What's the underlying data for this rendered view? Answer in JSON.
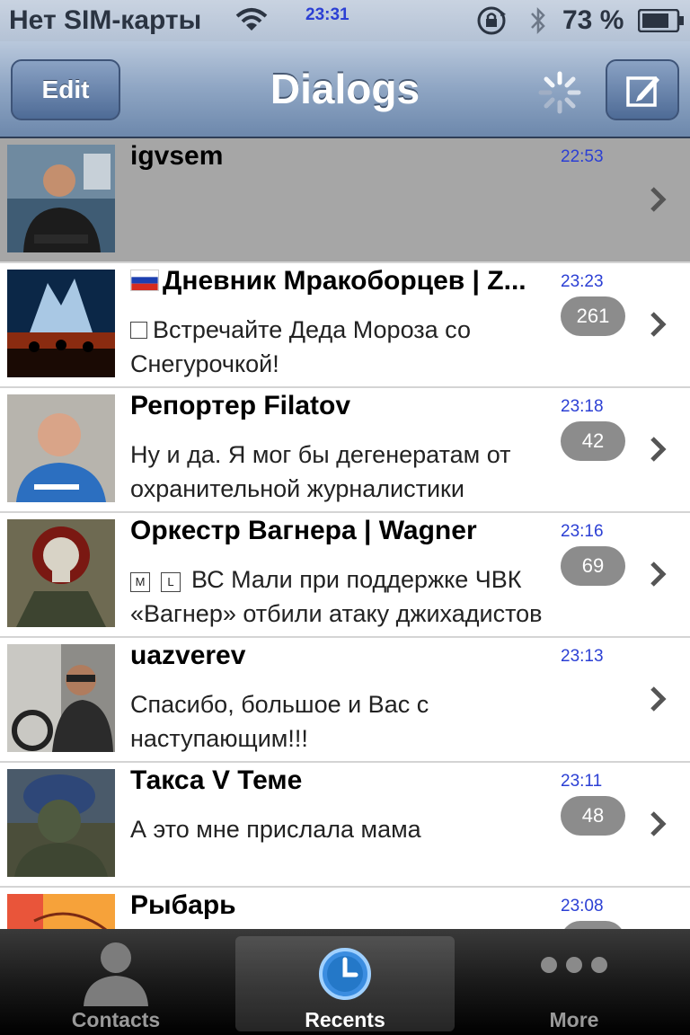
{
  "status_bar": {
    "carrier": "Нет SIM-карты",
    "time": "23:31",
    "battery_text": "73 %",
    "icons": [
      "wifi-icon",
      "rotation-lock-icon",
      "bluetooth-icon",
      "battery-icon"
    ]
  },
  "nav": {
    "title": "Dialogs",
    "edit_label": "Edit",
    "icons": [
      "activity-spinner-icon",
      "compose-icon"
    ]
  },
  "dialogs": [
    {
      "name": "igvsem",
      "time": "22:53",
      "message_lines": [],
      "badge": "",
      "selected": true
    },
    {
      "name": "Дневник Мракоборцев | Z...",
      "name_flag": "russian-flag-icon",
      "time": "23:23",
      "message_lines": [
        "Встречайте Деда Мороза со",
        "Снегурочкой!"
      ],
      "message_prefix": "square-icon",
      "badge": "261"
    },
    {
      "name": "Репортер Filatov",
      "time": "23:18",
      "message_lines": [
        "Ну и да. Я мог бы дегенератам от",
        "охранительной журналистики"
      ],
      "badge": "42"
    },
    {
      "name": "Оркестр Вагнера | Wagner",
      "time": "23:16",
      "message_tags": [
        "M",
        "L"
      ],
      "message_lines": [
        "ВС Мали при поддержке ЧВК",
        "«Вагнер» отбили атаку джихадистов"
      ],
      "badge": "69"
    },
    {
      "name": "uazverev",
      "time": "23:13",
      "message_lines": [
        "Спасибо, большое и Вас с",
        "наступающим!!!"
      ],
      "badge": ""
    },
    {
      "name": "Такса V Теме",
      "time": "23:11",
      "message_lines": [
        "А это мне прислала мама"
      ],
      "badge": "48"
    },
    {
      "name": "Рыбарь",
      "time": "23:08",
      "message_lines": [],
      "badge": ""
    }
  ],
  "tabbar": {
    "tabs": [
      {
        "label": "Contacts",
        "icon": "person-icon"
      },
      {
        "label": "Recents",
        "icon": "clock-icon",
        "active": true
      },
      {
        "label": "More",
        "icon": "more-dots-icon"
      }
    ]
  },
  "colors": {
    "time_text": "#2b3fd4",
    "badge_bg": "#8c8c8c",
    "selected_row": "#a6a6a6",
    "navbar": "#8ea5c3"
  }
}
